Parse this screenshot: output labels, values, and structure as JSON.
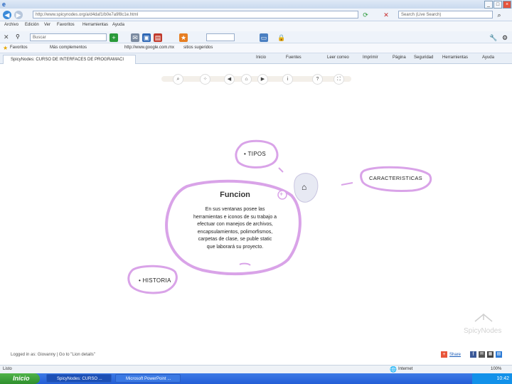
{
  "browser": {
    "address": "http://www.spicynodes.org/a/d4daf1/b0e7a9f8c1e.html",
    "search_placeholder": "Search (Live Search)",
    "toolbar_search": "Buscar",
    "menu": [
      "Archivo",
      "Edición",
      "Ver",
      "Favoritos",
      "Herramientas",
      "Ayuda"
    ],
    "favorites_label": "Favoritos",
    "favorites": [
      "Más complementos",
      "http://www.google.com.mx",
      "sitios sugeridos"
    ],
    "tab_title": "SpicyNodes: CURSO DE INTERFACES DE PROGRAMACI",
    "commands": [
      "Inicio",
      "Fuentes",
      "Leer correo",
      "Imprimir",
      "Página",
      "Seguridad",
      "Herramientas",
      "Ayuda"
    ]
  },
  "mindmap": {
    "tipos": "• TIPOS",
    "caracteristicas": "CARACTERISTICAS",
    "funcion_title": "Funcion",
    "funcion_text": [
      "En sus ventanas posee las",
      "herramientas e iconos de su trabajo a",
      "efectuar con manejos de archivos,",
      "encapsulamientos, polimorfismos,",
      "carpetas de clase, se puble static",
      "que laborará su proyecto."
    ],
    "historia": "• HISTORIA",
    "logo": "SpicyNodes"
  },
  "footer": {
    "logged_in": "Logged in as: Giovanny | Go to \"Lion details\"",
    "share": "Share"
  },
  "status": {
    "left": "Listo",
    "zone": "Internet",
    "zoom": "100%"
  },
  "taskbar": {
    "start": "Inicio",
    "tasks": [
      "SpicyNodes: CURSO ...",
      "Microsoft PowerPoint ..."
    ],
    "clock": "10:42"
  }
}
